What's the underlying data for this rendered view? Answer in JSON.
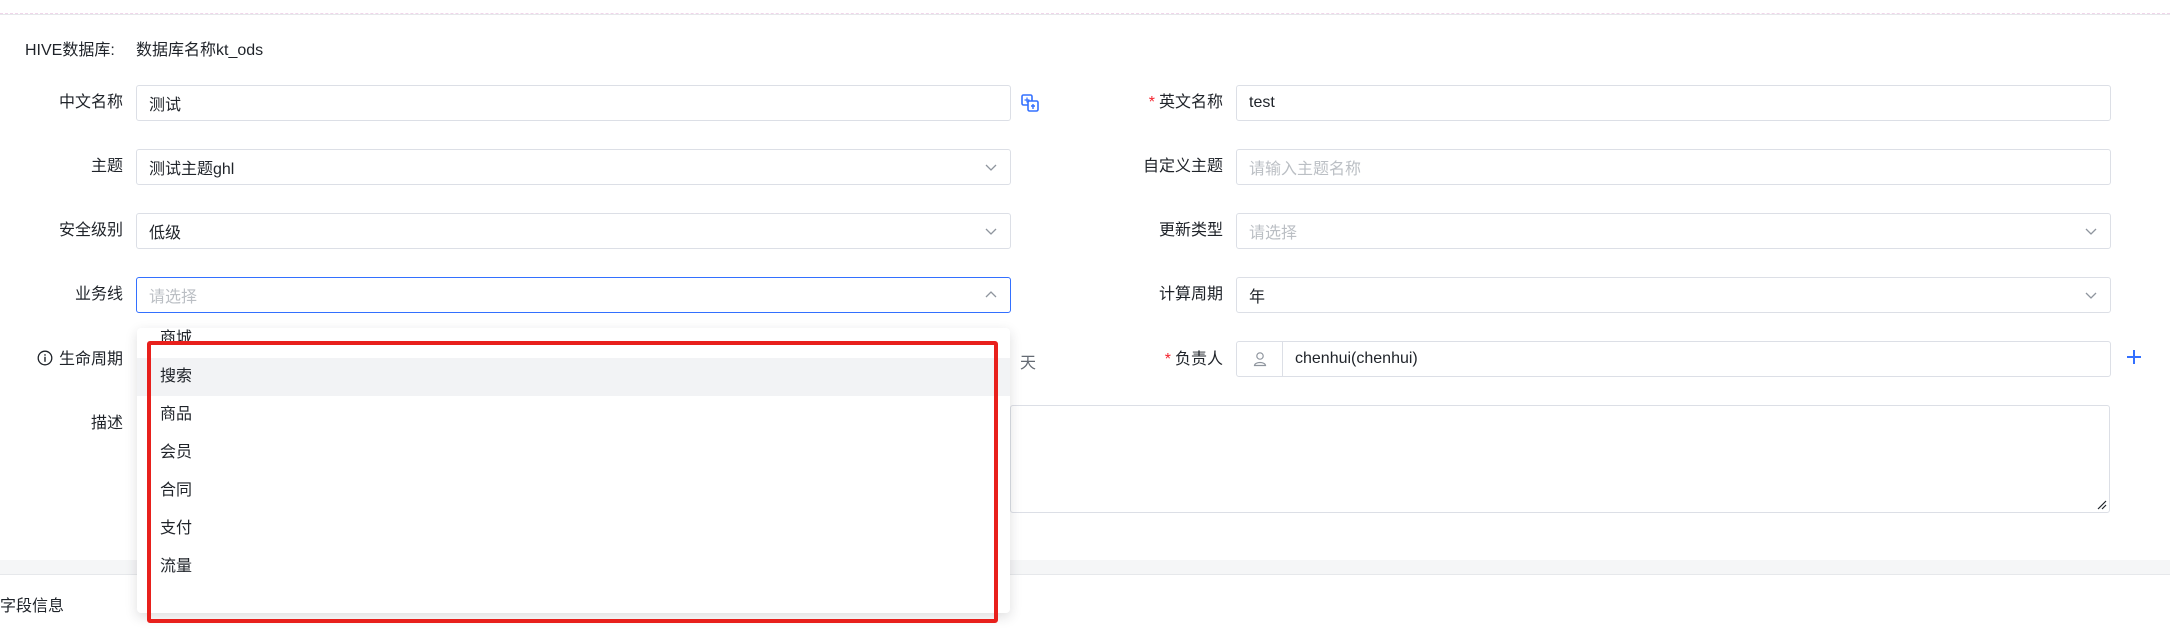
{
  "hive": {
    "label": "HIVE数据库:",
    "value": "数据库名称kt_ods"
  },
  "form": {
    "cn_name": {
      "label": "中文名称",
      "value": "测试"
    },
    "en_name": {
      "required": "*",
      "label": "英文名称",
      "value": "test"
    },
    "topic": {
      "label": "主题",
      "value": "测试主题ghl"
    },
    "custom_topic": {
      "label": "自定义主题",
      "placeholder": "请输入主题名称"
    },
    "security": {
      "label": "安全级别",
      "value": "低级"
    },
    "update_type": {
      "label": "更新类型",
      "placeholder": "请选择"
    },
    "business_line": {
      "label": "业务线",
      "placeholder": "请选择"
    },
    "calc_period": {
      "label": "计算周期",
      "value": "年"
    },
    "lifecycle": {
      "label": "生命周期",
      "unit": "天"
    },
    "owner": {
      "required": "*",
      "label": "负责人",
      "value": "chenhui(chenhui)"
    },
    "description": {
      "label": "描述"
    }
  },
  "dropdown": {
    "items": [
      "商城",
      "搜索",
      "商品",
      "会员",
      "合同",
      "支付",
      "流量"
    ],
    "hovered_index": 1
  },
  "section": {
    "field_info": "字段信息"
  },
  "colors": {
    "accent": "#3370ff",
    "highlight": "#e8201c",
    "required": "#f5222d"
  }
}
